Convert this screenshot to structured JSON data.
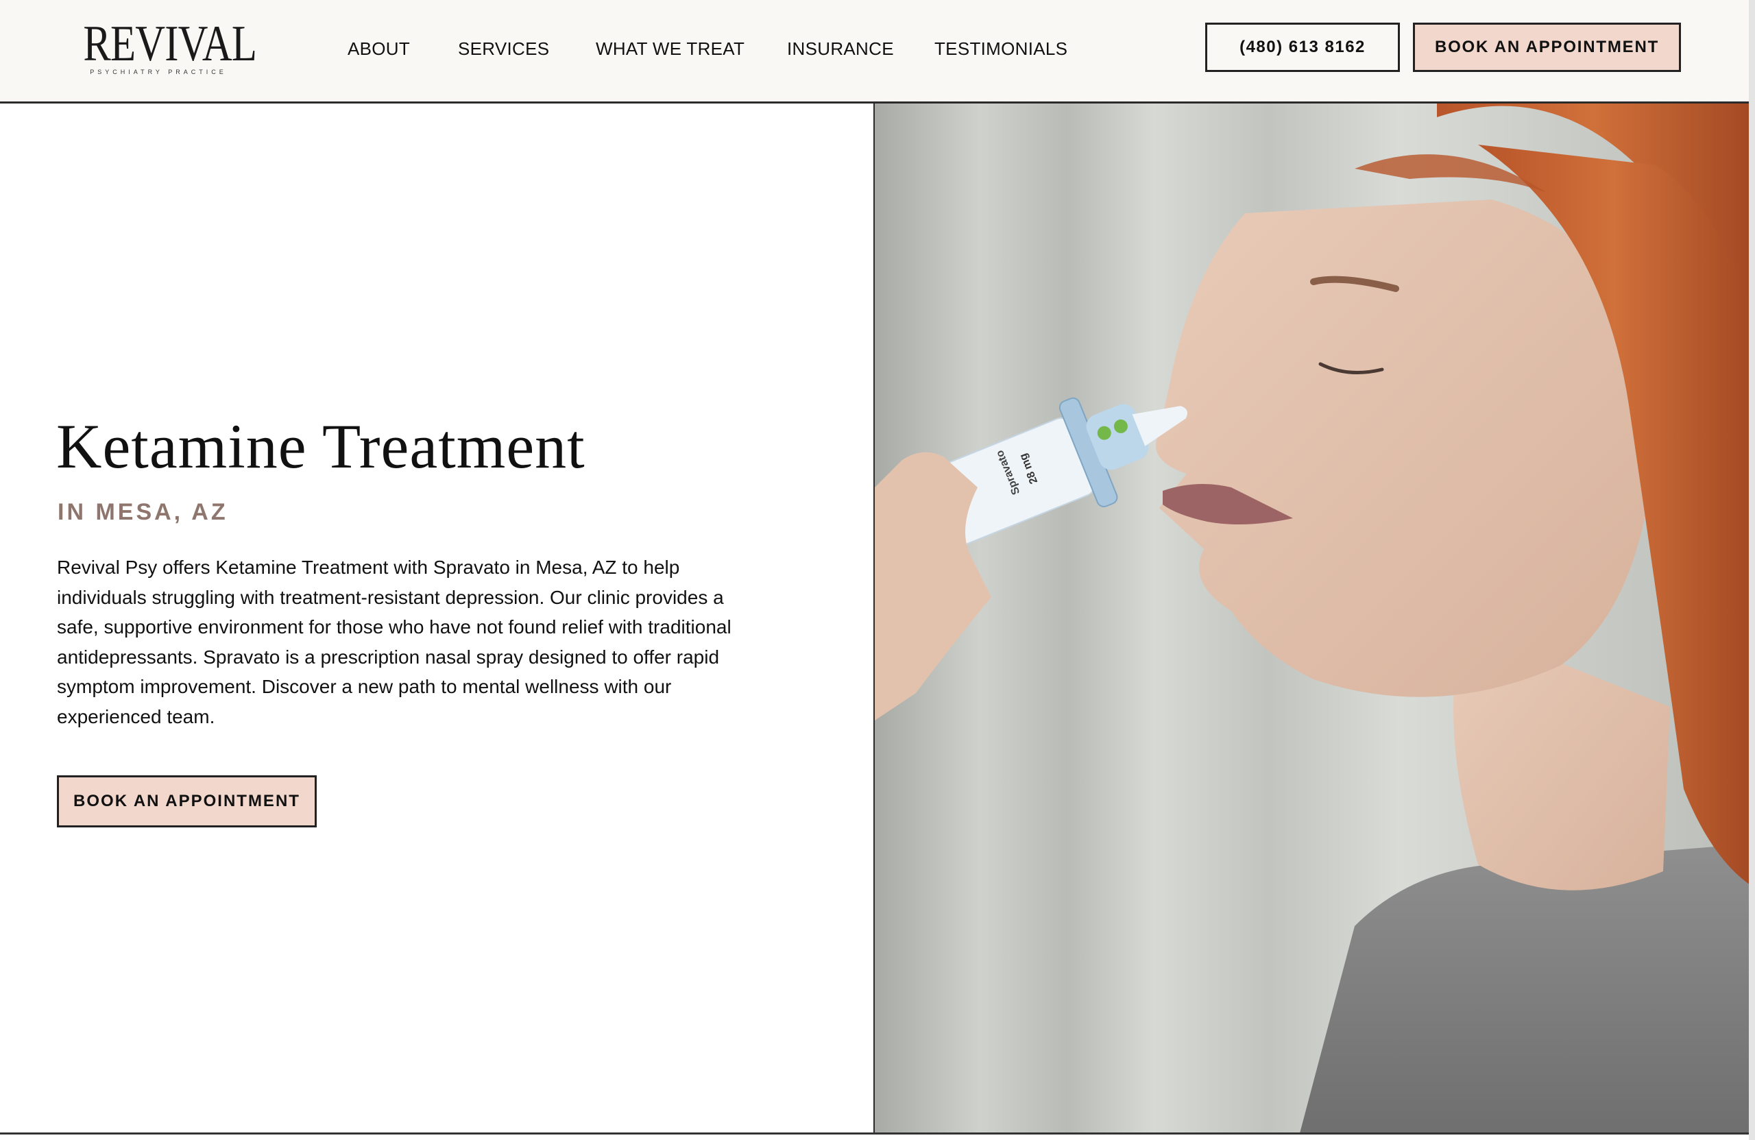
{
  "brand": {
    "name": "REVIVAL",
    "tagline": "PSYCHIATRY PRACTICE"
  },
  "nav": {
    "items": [
      {
        "label": "ABOUT"
      },
      {
        "label": "SERVICES"
      },
      {
        "label": "WHAT WE TREAT"
      },
      {
        "label": "INSURANCE"
      },
      {
        "label": "TESTIMONIALS"
      }
    ],
    "phone": "(480) 613 8162",
    "cta": "BOOK AN APPOINTMENT"
  },
  "hero": {
    "title": "Ketamine Treatment",
    "subtitle": "IN MESA, AZ",
    "body": "Revival Psy offers Ketamine Treatment with Spravato in Mesa, AZ to help individuals struggling with treatment-resistant depression. Our clinic provides a safe, supportive environment for those who have not found relief with traditional antidepressants. Spravato is a prescription nasal spray designed to offer rapid symptom improvement. Discover a new path to mental wellness with our experienced team.",
    "cta": "BOOK AN APPOINTMENT",
    "image": {
      "device_brand": "Spravato",
      "device_dose": "28 mg"
    }
  },
  "colors": {
    "header_bg": "#f9f8f5",
    "cta_pink": "#f1d7cc",
    "subtitle_taupe": "#8e766e",
    "text": "#111111"
  }
}
